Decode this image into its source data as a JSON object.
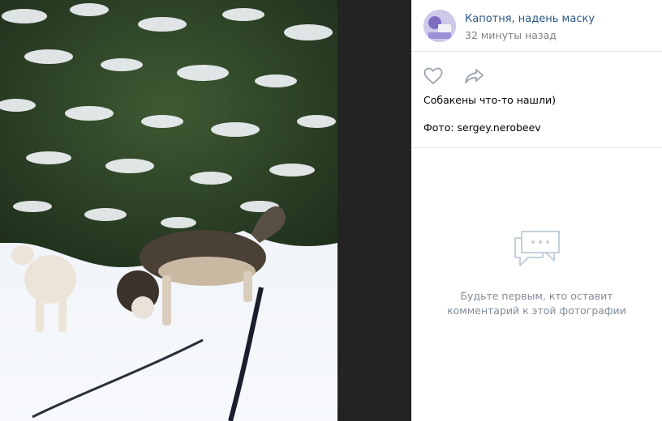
{
  "post": {
    "author": "Капотня, надень маску",
    "time": "32 минуты назад",
    "caption": "Собакены что-то нашли)",
    "credit": "Фото: sergey.nerobeev"
  },
  "actions": {
    "like_icon": "heart-icon",
    "share_icon": "share-arrow-icon"
  },
  "comments": {
    "empty_line1": "Будьте первым, кто оставит",
    "empty_line2": "комментарий к этой фотографии",
    "icon": "comments-bubble-icon"
  },
  "colors": {
    "link": "#2a5885",
    "muted": "#828282",
    "hint": "#818c99",
    "icon": "#99a2ad"
  }
}
